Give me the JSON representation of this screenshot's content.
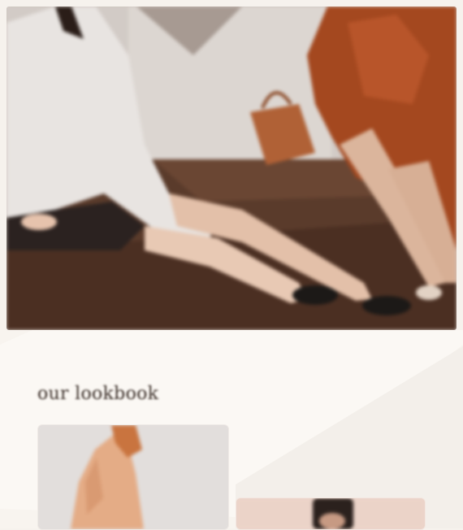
{
  "hero": {
    "image_icon": "hero-photo-two-women-seated",
    "caption_lines": [
      "",
      "",
      ""
    ]
  },
  "lookbook": {
    "eyebrow": "",
    "title": "our lookbook",
    "cards": [
      {
        "image_icon": "lookbook-photo-model-blush-outfit"
      },
      {
        "image_icon": "lookbook-photo-model-portrait"
      }
    ]
  },
  "colors": {
    "background": "#f6f2ed",
    "hero_floor": "#5b3a28",
    "dress_rust": "#a4481f",
    "title_text": "#3a2e28",
    "card_blush": "#ecd6cc"
  }
}
